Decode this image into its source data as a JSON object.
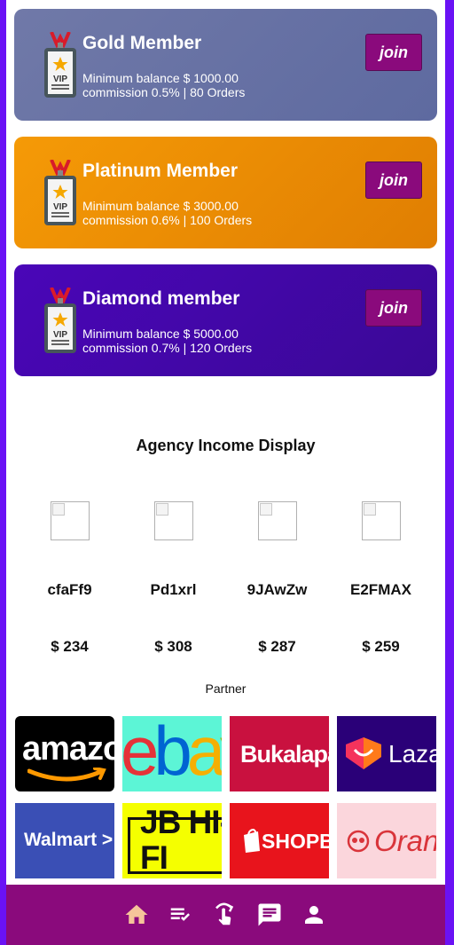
{
  "colors": {
    "frame": "#6a12f5",
    "join_button": "#8a0a7c",
    "navbar": "#8a0a7c",
    "nav_active": "#f5c49a",
    "nav_inactive": "#ffffff"
  },
  "levels": [
    {
      "title": "Gold Member",
      "line1": "Minimum balance $ 1000.00",
      "line2": "commission 0.5% | 80 Orders",
      "button": "join",
      "icon": "vip-badge-icon"
    },
    {
      "title": "Platinum Member",
      "line1": "Minimum balance $ 3000.00",
      "line2": "commission 0.6% | 100 Orders",
      "button": "join",
      "icon": "vip-badge-icon"
    },
    {
      "title": "Diamond member",
      "line1": "Minimum balance $ 5000.00",
      "line2": "commission 0.7% | 120 Orders",
      "button": "join",
      "icon": "vip-badge-icon"
    }
  ],
  "income": {
    "title": "Agency Income Display",
    "agents": [
      {
        "name": "cfaFf9",
        "amount": "$ 234"
      },
      {
        "name": "Pd1xrl",
        "amount": "$ 308"
      },
      {
        "name": "9JAwZw",
        "amount": "$ 287"
      },
      {
        "name": "E2FMAX",
        "amount": "$ 259"
      }
    ]
  },
  "partners": {
    "label": "Partner",
    "logos": [
      {
        "text": "amazo",
        "name": "amazon"
      },
      {
        "text": "ebay",
        "name": "ebay"
      },
      {
        "text": "Bukalapa",
        "name": "bukalapak"
      },
      {
        "text": "Lazac",
        "name": "lazada"
      },
      {
        "text": "Walmart >",
        "name": "walmart"
      },
      {
        "text": "JB HI-FI",
        "name": "jb-hi-fi"
      },
      {
        "text": "SHOPBC",
        "name": "shopbop"
      },
      {
        "text": "Oran",
        "name": "orange"
      }
    ]
  },
  "nav": [
    {
      "icon": "home-icon",
      "active": true
    },
    {
      "icon": "order-list-icon",
      "active": false
    },
    {
      "icon": "tap-gesture-icon",
      "active": false
    },
    {
      "icon": "chat-icon",
      "active": false
    },
    {
      "icon": "profile-icon",
      "active": false
    }
  ]
}
